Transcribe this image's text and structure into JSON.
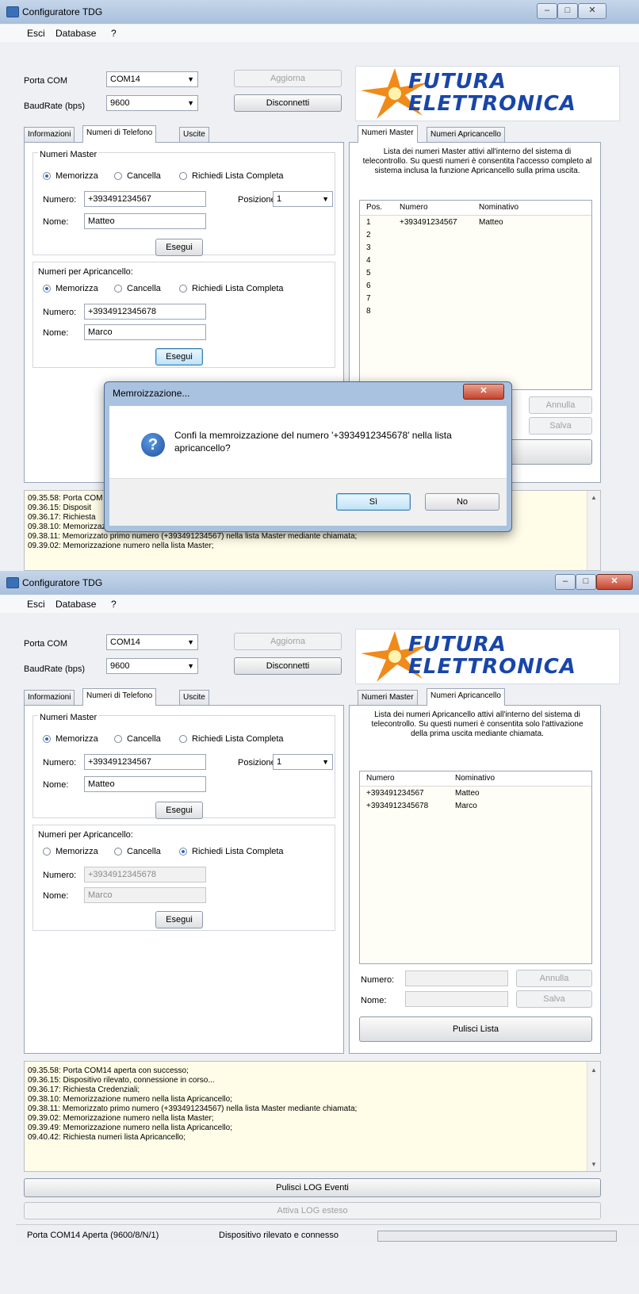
{
  "shot1": {
    "title": "Configuratore TDG",
    "window_buttons": [
      "–",
      "□",
      "✕"
    ],
    "menu": [
      "Esci",
      "Database",
      "?"
    ],
    "porta_com_label": "Porta COM",
    "porta_com_value": "COM14",
    "baud_label": "BaudRate (bps)",
    "baud_value": "9600",
    "aggiorna": "Aggiorna",
    "disconnetti": "Disconnetti",
    "logo_line1": "FUTURA",
    "logo_line2": "ELETTRONICA",
    "tabs_left": [
      "Informazioni",
      "Numeri di Telefono",
      "Uscite"
    ],
    "master_group": "Numeri Master",
    "radio_memorizza": "Memorizza",
    "radio_cancella": "Cancella",
    "radio_richiedi": "Richiedi Lista Completa",
    "numero_label": "Numero:",
    "nome_label": "Nome:",
    "master_numero": "+393491234567",
    "master_nome": "Matteo",
    "posizione_label": "Posizione:",
    "posizione_value": "1",
    "esegui": "Esegui",
    "apri_group": "Numeri per Apricancello:",
    "apri_numero": "+3934912345678",
    "apri_nome": "Marco",
    "tabs_right": [
      "Numeri Master",
      "Numeri Apricancello"
    ],
    "right_desc": "Lista dei numeri Master attivi all'interno del sistema di telecontrollo. Su questi numeri è consentita l'accesso completo al sistema inclusa la funzione Apricancello sulla prima uscita.",
    "list_headers": [
      "Pos.",
      "Numero",
      "Nominativo"
    ],
    "list_rows": [
      {
        "pos": "1",
        "numero": "+393491234567",
        "nome": "Matteo"
      },
      {
        "pos": "2",
        "numero": "",
        "nome": ""
      },
      {
        "pos": "3",
        "numero": "",
        "nome": ""
      },
      {
        "pos": "4",
        "numero": "",
        "nome": ""
      },
      {
        "pos": "5",
        "numero": "",
        "nome": ""
      },
      {
        "pos": "6",
        "numero": "",
        "nome": ""
      },
      {
        "pos": "7",
        "numero": "",
        "nome": ""
      },
      {
        "pos": "8",
        "numero": "",
        "nome": ""
      }
    ],
    "annulla": "Annulla",
    "salva": "Salva",
    "log_lines": [
      "09.35.58: Porta COM",
      "09.36.15: Disposit",
      "09.36.17: Richiesta",
      "09.38.10: Memorizzazione numero nella lista Apricancello;",
      "09.38.11: Memorizzato primo numero (+393491234567) nella lista Master mediante chiamata;",
      "09.39.02: Memorizzazione numero nella lista Master;"
    ],
    "dialog": {
      "title": "Memroizzazione...",
      "close": "✕",
      "icon": "?",
      "message_line1": "Confi la memroizzazione del numero '+3934912345678' nella lista",
      "message_line2": "apricancello?",
      "yes": "Sì",
      "no": "No"
    }
  },
  "shot2": {
    "title": "Configuratore TDG",
    "window_buttons": [
      "–",
      "□",
      "✕"
    ],
    "menu": [
      "Esci",
      "Database",
      "?"
    ],
    "porta_com_label": "Porta COM",
    "porta_com_value": "COM14",
    "baud_label": "BaudRate (bps)",
    "baud_value": "9600",
    "aggiorna": "Aggiorna",
    "disconnetti": "Disconnetti",
    "logo_line1": "FUTURA",
    "logo_line2": "ELETTRONICA",
    "tabs_left": [
      "Informazioni",
      "Numeri di Telefono",
      "Uscite"
    ],
    "master_group": "Numeri Master",
    "radio_memorizza": "Memorizza",
    "radio_cancella": "Cancella",
    "radio_richiedi": "Richiedi Lista Completa",
    "numero_label": "Numero:",
    "nome_label": "Nome:",
    "master_numero": "+393491234567",
    "master_nome": "Matteo",
    "posizione_label": "Posizione:",
    "posizione_value": "1",
    "esegui": "Esegui",
    "apri_group": "Numeri per Apricancello:",
    "apri_numero": "+3934912345678",
    "apri_nome": "Marco",
    "tabs_right": [
      "Numeri Master",
      "Numeri Apricancello"
    ],
    "right_desc": "Lista dei numeri Apricancello attivi all'interno del sistema di telecontrollo. Su questi numeri è consentita solo l'attivazione della prima uscita mediante chiamata.",
    "list_headers": [
      "Numero",
      "Nominativo"
    ],
    "list_rows": [
      {
        "numero": "+393491234567",
        "nome": "Matteo"
      },
      {
        "numero": "+3934912345678",
        "nome": "Marco"
      }
    ],
    "numero_field_label": "Numero:",
    "nome_field_label": "Nome:",
    "annulla": "Annulla",
    "salva": "Salva",
    "pulisci_lista": "Pulisci Lista",
    "log_lines": [
      "09.35.58: Porta COM14 aperta con successo;",
      "09.36.15: Dispositivo rilevato, connessione in corso...",
      "09.36.17: Richiesta Credenziali;",
      "09.38.10: Memorizzazione numero nella lista Apricancello;",
      "09.38.11: Memorizzato primo numero (+393491234567) nella lista Master mediante chiamata;",
      "09.39.02: Memorizzazione numero nella lista Master;",
      "09.39.49: Memorizzazione numero nella lista Apricancello;",
      "09.40.42: Richiesta numeri lista Apricancello;"
    ],
    "pulisci_log": "Pulisci LOG Eventi",
    "attiva_log": "Attiva LOG esteso",
    "status_left": "Porta COM14 Aperta (9600/8/N/1)",
    "status_right": "Dispositivo rilevato e connesso",
    "progress_fraction": 0
  }
}
